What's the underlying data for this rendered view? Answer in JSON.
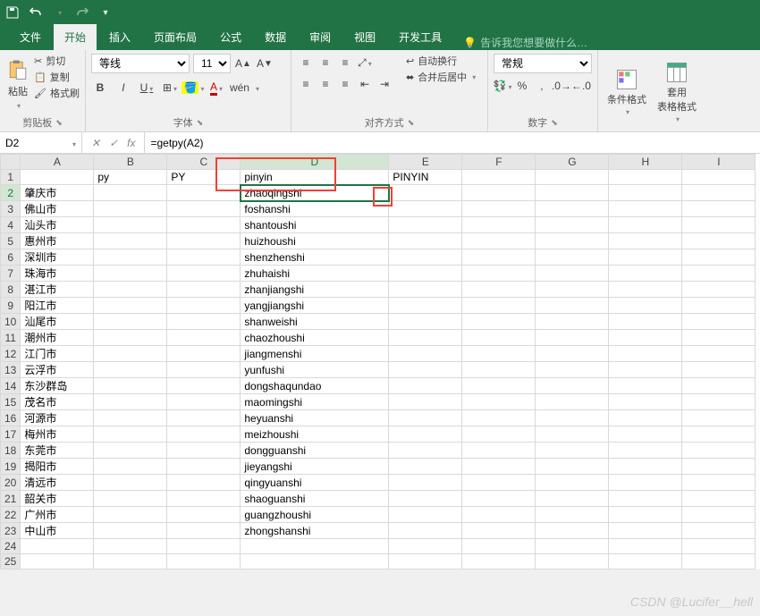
{
  "titlebar": {
    "icons": [
      "save-icon",
      "undo-icon",
      "redo-icon",
      "more-icon"
    ]
  },
  "tabs": {
    "file": "文件",
    "home": "开始",
    "insert": "插入",
    "layout": "页面布局",
    "formula": "公式",
    "data": "数据",
    "review": "审阅",
    "view": "视图",
    "dev": "开发工具",
    "hint": "告诉我您想要做什么…"
  },
  "ribbon": {
    "clipboard": {
      "title": "剪贴板",
      "paste": "粘贴",
      "cut": "剪切",
      "copy": "复制",
      "format_painter": "格式刷"
    },
    "font": {
      "title": "字体",
      "name": "等线",
      "size": "11",
      "wen": "wén"
    },
    "align": {
      "title": "对齐方式",
      "wrap": "自动换行",
      "merge": "合并后居中"
    },
    "number": {
      "title": "数字",
      "format": "常规"
    },
    "styles": {
      "cond": "条件格式",
      "table": "套用\n表格格式"
    }
  },
  "cellref": {
    "name": "D2",
    "formula": "=getpy(A2)"
  },
  "columns": [
    "A",
    "B",
    "C",
    "D",
    "E",
    "F",
    "G",
    "H",
    "I"
  ],
  "rows": [
    {
      "n": 1,
      "A": "",
      "B": "py",
      "C": "PY",
      "D": "pinyin",
      "E": "PINYIN"
    },
    {
      "n": 2,
      "A": "肇庆市",
      "D": "zhaoqingshi"
    },
    {
      "n": 3,
      "A": "佛山市",
      "D": "foshanshi"
    },
    {
      "n": 4,
      "A": "汕头市",
      "D": "shantoushi"
    },
    {
      "n": 5,
      "A": "惠州市",
      "D": "huizhoushi"
    },
    {
      "n": 6,
      "A": "深圳市",
      "D": "shenzhenshi"
    },
    {
      "n": 7,
      "A": "珠海市",
      "D": "zhuhaishi"
    },
    {
      "n": 8,
      "A": "湛江市",
      "D": "zhanjiangshi"
    },
    {
      "n": 9,
      "A": "阳江市",
      "D": "yangjiangshi"
    },
    {
      "n": 10,
      "A": "汕尾市",
      "D": "shanweishi"
    },
    {
      "n": 11,
      "A": "潮州市",
      "D": "chaozhoushi"
    },
    {
      "n": 12,
      "A": "江门市",
      "D": "jiangmenshi"
    },
    {
      "n": 13,
      "A": "云浮市",
      "D": "yunfushi"
    },
    {
      "n": 14,
      "A": "东沙群岛",
      "D": "dongshaqundao"
    },
    {
      "n": 15,
      "A": "茂名市",
      "D": "maomingshi"
    },
    {
      "n": 16,
      "A": "河源市",
      "D": "heyuanshi"
    },
    {
      "n": 17,
      "A": "梅州市",
      "D": "meizhoushi"
    },
    {
      "n": 18,
      "A": "东莞市",
      "D": "dongguanshi"
    },
    {
      "n": 19,
      "A": "揭阳市",
      "D": "jieyangshi"
    },
    {
      "n": 20,
      "A": "清远市",
      "D": "qingyuanshi"
    },
    {
      "n": 21,
      "A": "韶关市",
      "D": "shaoguanshi"
    },
    {
      "n": 22,
      "A": "广州市",
      "D": "guangzhoushi"
    },
    {
      "n": 23,
      "A": "中山市",
      "D": "zhongshanshi"
    },
    {
      "n": 24
    },
    {
      "n": 25
    }
  ],
  "watermark": "CSDN @Lucifer__hell"
}
